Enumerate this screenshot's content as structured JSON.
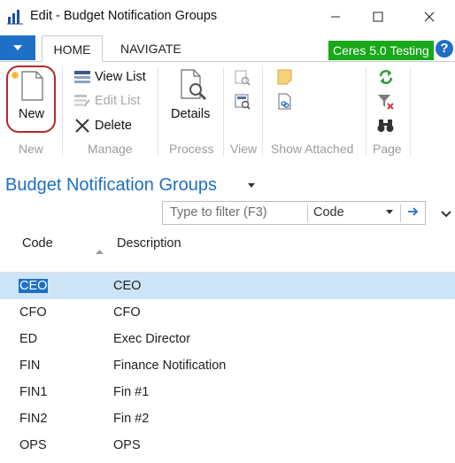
{
  "window": {
    "title": "Edit - Budget Notification Groups"
  },
  "ribbon": {
    "tabs": [
      {
        "label": "HOME",
        "active": true
      },
      {
        "label": "NAVIGATE",
        "active": false
      }
    ],
    "company_badge": "Ceres 5.0 Testing",
    "help_icon": "?",
    "groups": {
      "new": {
        "label": "New",
        "new_button": "New"
      },
      "manage": {
        "label": "Manage",
        "view_list": "View List",
        "edit_list": "Edit List",
        "delete": "Delete"
      },
      "process": {
        "label": "Process",
        "details": "Details"
      },
      "view": {
        "label": "View"
      },
      "show_attached": {
        "label": "Show Attached"
      },
      "page": {
        "label": "Page"
      }
    }
  },
  "page": {
    "title": "Budget Notification Groups"
  },
  "filter": {
    "placeholder": "Type to filter (F3)",
    "field": "Code"
  },
  "table": {
    "columns": [
      "Code",
      "Description"
    ],
    "sorted_column": "Code",
    "selected_row": 0,
    "rows": [
      {
        "code": "CEO",
        "description": "CEO"
      },
      {
        "code": "CFO",
        "description": "CFO"
      },
      {
        "code": "ED",
        "description": "Exec Director"
      },
      {
        "code": "FIN",
        "description": "Finance Notification"
      },
      {
        "code": "FIN1",
        "description": "Fin #1"
      },
      {
        "code": "FIN2",
        "description": "Fin #2"
      },
      {
        "code": "OPS",
        "description": "OPS"
      }
    ]
  },
  "colors": {
    "accent": "#1e6fc6",
    "company_badge": "#18a81a",
    "selected_row": "#cde4f7",
    "new_highlight": "#b22a2a"
  }
}
